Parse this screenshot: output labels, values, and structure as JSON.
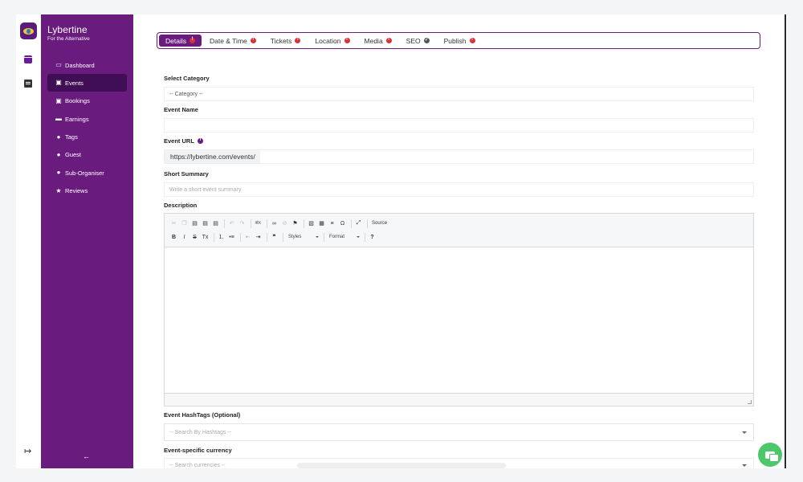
{
  "brand": {
    "name": "Lybertine",
    "tagline": "For the Alternative"
  },
  "sidebar": {
    "items": [
      {
        "label": "Dashboard",
        "icon": "monitor-icon",
        "glyph": "▭",
        "active": false
      },
      {
        "label": "Events",
        "icon": "calendar-icon",
        "glyph": "▣",
        "active": true
      },
      {
        "label": "Bookings",
        "icon": "calendar-check-icon",
        "glyph": "▣",
        "active": false
      },
      {
        "label": "Earnings",
        "icon": "money-icon",
        "glyph": "▬",
        "active": false
      },
      {
        "label": "Tags",
        "icon": "user-tag-icon",
        "glyph": "●",
        "active": false
      },
      {
        "label": "Guest",
        "icon": "users-icon",
        "glyph": "●",
        "active": false
      },
      {
        "label": "Sub-Organiser",
        "icon": "user-icon",
        "glyph": "●",
        "active": false
      },
      {
        "label": "Reviews",
        "icon": "star-icon",
        "glyph": "★",
        "active": false
      }
    ]
  },
  "tabs": [
    {
      "label": "Details",
      "status": "error",
      "active": true
    },
    {
      "label": "Date & Time",
      "status": "error",
      "active": false
    },
    {
      "label": "Tickets",
      "status": "error",
      "active": false
    },
    {
      "label": "Location",
      "status": "error",
      "active": false
    },
    {
      "label": "Media",
      "status": "error",
      "active": false
    },
    {
      "label": "SEO",
      "status": "ok",
      "active": false
    },
    {
      "label": "Publish",
      "status": "error",
      "active": false
    }
  ],
  "form": {
    "category_label": "Select Category",
    "category_value": "-- Category --",
    "event_name_label": "Event Name",
    "event_name_value": "",
    "event_url_label": "Event URL",
    "event_url_prefix": "https://lybertine.com/events/",
    "summary_label": "Short Summary",
    "summary_placeholder": "Write a short event summary",
    "description_label": "Description",
    "hashtags_label": "Event HashTags (Optional)",
    "hashtags_placeholder": "-- Search By Hashtags --",
    "currency_label": "Event-specific currency",
    "currency_placeholder": "-- Search currencies --"
  },
  "editor": {
    "source_label": "Source",
    "styles_label": "Styles",
    "format_label": "Format",
    "help_label": "?"
  },
  "colors": {
    "primary": "#6a1b7e",
    "active_nav": "#3f0e54",
    "error_badge": "#d9313b",
    "chat": "#4cc76a"
  }
}
